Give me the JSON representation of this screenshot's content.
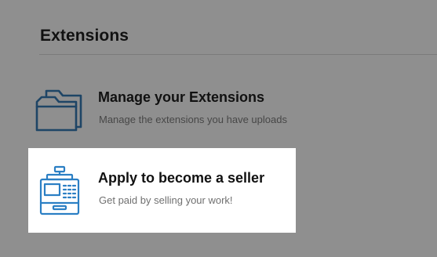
{
  "page": {
    "title": "Extensions"
  },
  "options": [
    {
      "title": "Manage your Extensions",
      "description": "Manage the extensions you have uploads",
      "icon": "folder-icon"
    },
    {
      "title": "Apply to become a seller",
      "description": "Get paid by selling your work!",
      "icon": "cash-register-icon"
    }
  ],
  "colors": {
    "icon_blue_dimmed": "#1e4566",
    "icon_blue": "#2b7fc4",
    "overlay_gray": "#8f8f8f",
    "highlight_white": "#ffffff"
  }
}
